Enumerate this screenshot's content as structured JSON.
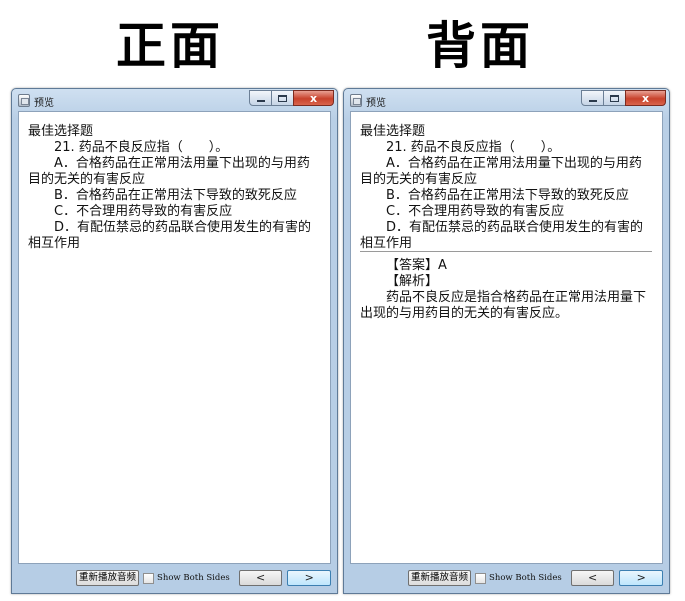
{
  "labels": {
    "front": "正面",
    "back": "背面"
  },
  "window": {
    "title": "预览",
    "controls": {
      "minimize_icon": "minimize-icon",
      "maximize_icon": "maximize-icon",
      "close_glyph": "x"
    }
  },
  "question": {
    "type": "最佳选择题",
    "stem": "21. 药品不良反应指（　　）。",
    "options": [
      "A．合格药品在正常用法用量下出现的与用药目的无关的有害反应",
      "B．合格药品在正常用法下导致的致死反应",
      "C．不合理用药导致的有害反应",
      "D．有配伍禁忌的药品联合使用发生的有害的相互作用"
    ]
  },
  "answer": {
    "answer_line": "【答案】A",
    "analysis_label": "【解析】",
    "analysis_text": "药品不良反应是指合格药品在正常用法用量下出现的与用药目的无关的有害反应。"
  },
  "bottom": {
    "replay_label": "重新播放音频",
    "show_both_label": "Show Both Sides",
    "show_both_checked": false,
    "prev_label": "<",
    "next_label": ">"
  },
  "colors": {
    "accent_next": "#bee6fd",
    "close_red": "#c8422c"
  }
}
